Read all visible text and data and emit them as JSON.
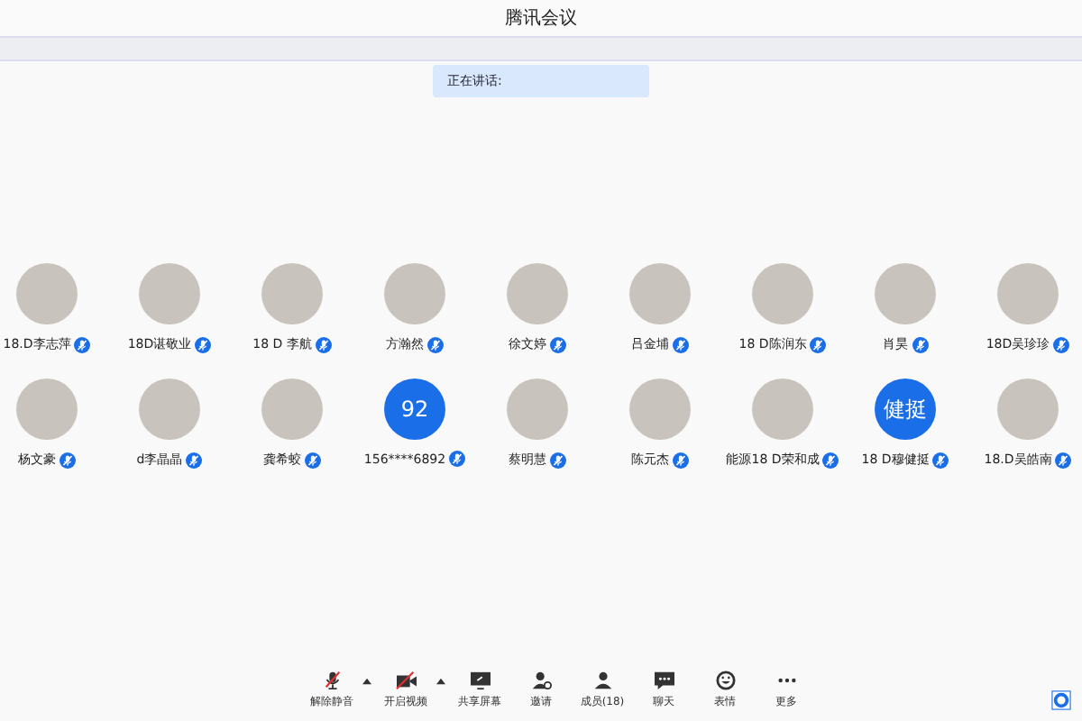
{
  "window": {
    "title": "腾讯会议"
  },
  "speaking": {
    "label": "正在讲话:"
  },
  "participants": [
    [
      {
        "name": "18.D李志萍",
        "kind": "photo"
      },
      {
        "name": "18D谌敬业",
        "kind": "photo"
      },
      {
        "name": "18 D 李航",
        "kind": "photo"
      },
      {
        "name": "方瀚然",
        "kind": "photo"
      },
      {
        "name": "徐文婷",
        "kind": "photo"
      },
      {
        "name": "吕金埔",
        "kind": "photo"
      },
      {
        "name": "18 D陈润东",
        "kind": "photo"
      },
      {
        "name": "肖昊",
        "kind": "photo"
      },
      {
        "name": "18D吴珍珍",
        "kind": "photo"
      }
    ],
    [
      {
        "name": "杨文豪",
        "kind": "photo"
      },
      {
        "name": "d李晶晶",
        "kind": "photo"
      },
      {
        "name": "龚希蛟",
        "kind": "photo"
      },
      {
        "name": "156****6892",
        "kind": "text",
        "initials": "92"
      },
      {
        "name": "蔡明慧",
        "kind": "photo"
      },
      {
        "name": "陈元杰",
        "kind": "photo"
      },
      {
        "name": "能源18 D荣和成",
        "kind": "photo"
      },
      {
        "name": "18 D穆健挺",
        "kind": "text",
        "initials": "健挺"
      },
      {
        "name": "18.D吴皓南",
        "kind": "photo"
      }
    ]
  ],
  "toolbar": [
    {
      "label": "解除静音",
      "kind": "mic",
      "caret": true
    },
    {
      "label": "开启视频",
      "kind": "video",
      "caret": true
    },
    {
      "label": "共享屏幕",
      "kind": "share",
      "caret": false
    },
    {
      "label": "邀请",
      "kind": "invite",
      "caret": false
    },
    {
      "label": "成员(18)",
      "kind": "members",
      "caret": false
    },
    {
      "label": "聊天",
      "kind": "chat",
      "caret": false
    },
    {
      "label": "表情",
      "kind": "emoji",
      "caret": false
    },
    {
      "label": "更多",
      "kind": "more",
      "caret": false
    }
  ]
}
